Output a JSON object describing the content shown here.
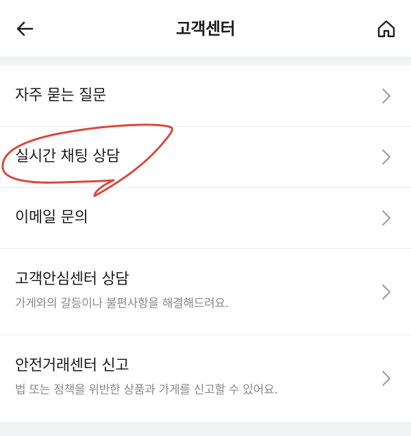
{
  "header": {
    "title": "고객센터",
    "back_icon": "arrow-left-icon",
    "home_icon": "home-icon"
  },
  "menu": {
    "items": [
      {
        "label": "자주 묻는 질문",
        "sub": ""
      },
      {
        "label": "실시간 채팅 상담",
        "sub": ""
      },
      {
        "label": "이메일 문의",
        "sub": ""
      },
      {
        "label": "고객안심센터 상담",
        "sub": "가게와의 갈등이나 불편사항을 해결해드려요."
      },
      {
        "label": "안전거래센터 신고",
        "sub": "법 또는 정책을 위반한 상품과 가게를 신고할 수 있어요."
      }
    ]
  },
  "colors": {
    "annotation_stroke": "#d9483b",
    "chevron": "#9a9a9a",
    "background": "#f2f3f5"
  }
}
